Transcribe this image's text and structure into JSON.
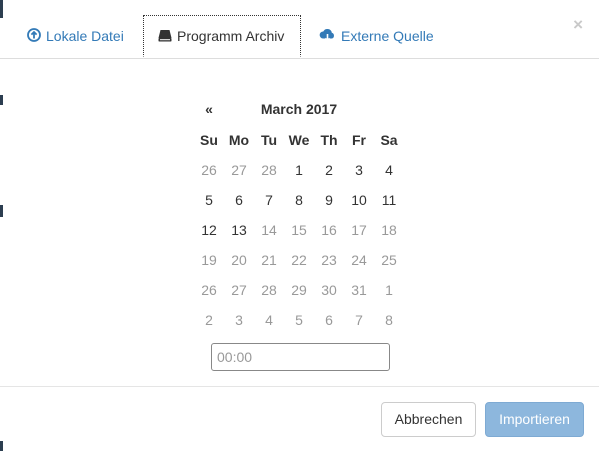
{
  "tabs": {
    "local": {
      "label": "Lokale Datei",
      "icon": "circle-arrow-up-icon"
    },
    "archive": {
      "label": "Programm Archiv",
      "icon": "hard-drive-icon"
    },
    "external": {
      "label": "Externe Quelle",
      "icon": "cloud-download-icon"
    },
    "close_label": "×"
  },
  "datepicker": {
    "prev_label": "«",
    "month_label": "March 2017",
    "weekdays": [
      "Su",
      "Mo",
      "Tu",
      "We",
      "Th",
      "Fr",
      "Sa"
    ],
    "weeks": [
      [
        {
          "d": "26",
          "m": true
        },
        {
          "d": "27",
          "m": true
        },
        {
          "d": "28",
          "m": true
        },
        {
          "d": "1",
          "m": false
        },
        {
          "d": "2",
          "m": false
        },
        {
          "d": "3",
          "m": false
        },
        {
          "d": "4",
          "m": false
        }
      ],
      [
        {
          "d": "5",
          "m": false
        },
        {
          "d": "6",
          "m": false
        },
        {
          "d": "7",
          "m": false
        },
        {
          "d": "8",
          "m": false
        },
        {
          "d": "9",
          "m": false
        },
        {
          "d": "10",
          "m": false
        },
        {
          "d": "11",
          "m": false
        }
      ],
      [
        {
          "d": "12",
          "m": false
        },
        {
          "d": "13",
          "m": false
        },
        {
          "d": "14",
          "m": true
        },
        {
          "d": "15",
          "m": true
        },
        {
          "d": "16",
          "m": true
        },
        {
          "d": "17",
          "m": true
        },
        {
          "d": "18",
          "m": true
        }
      ],
      [
        {
          "d": "19",
          "m": true
        },
        {
          "d": "20",
          "m": true
        },
        {
          "d": "21",
          "m": true
        },
        {
          "d": "22",
          "m": true
        },
        {
          "d": "23",
          "m": true
        },
        {
          "d": "24",
          "m": true
        },
        {
          "d": "25",
          "m": true
        }
      ],
      [
        {
          "d": "26",
          "m": true
        },
        {
          "d": "27",
          "m": true
        },
        {
          "d": "28",
          "m": true
        },
        {
          "d": "29",
          "m": true
        },
        {
          "d": "30",
          "m": true
        },
        {
          "d": "31",
          "m": true
        },
        {
          "d": "1",
          "m": true
        }
      ],
      [
        {
          "d": "2",
          "m": true
        },
        {
          "d": "3",
          "m": true
        },
        {
          "d": "4",
          "m": true
        },
        {
          "d": "5",
          "m": true
        },
        {
          "d": "6",
          "m": true
        },
        {
          "d": "7",
          "m": true
        },
        {
          "d": "8",
          "m": true
        }
      ]
    ]
  },
  "time": {
    "placeholder": "00:00",
    "value": ""
  },
  "footer": {
    "cancel_label": "Abbrechen",
    "import_label": "Importieren"
  },
  "colors": {
    "link": "#337ab7",
    "primary_disabled": "#8db7dd",
    "muted_day": "#999999"
  }
}
